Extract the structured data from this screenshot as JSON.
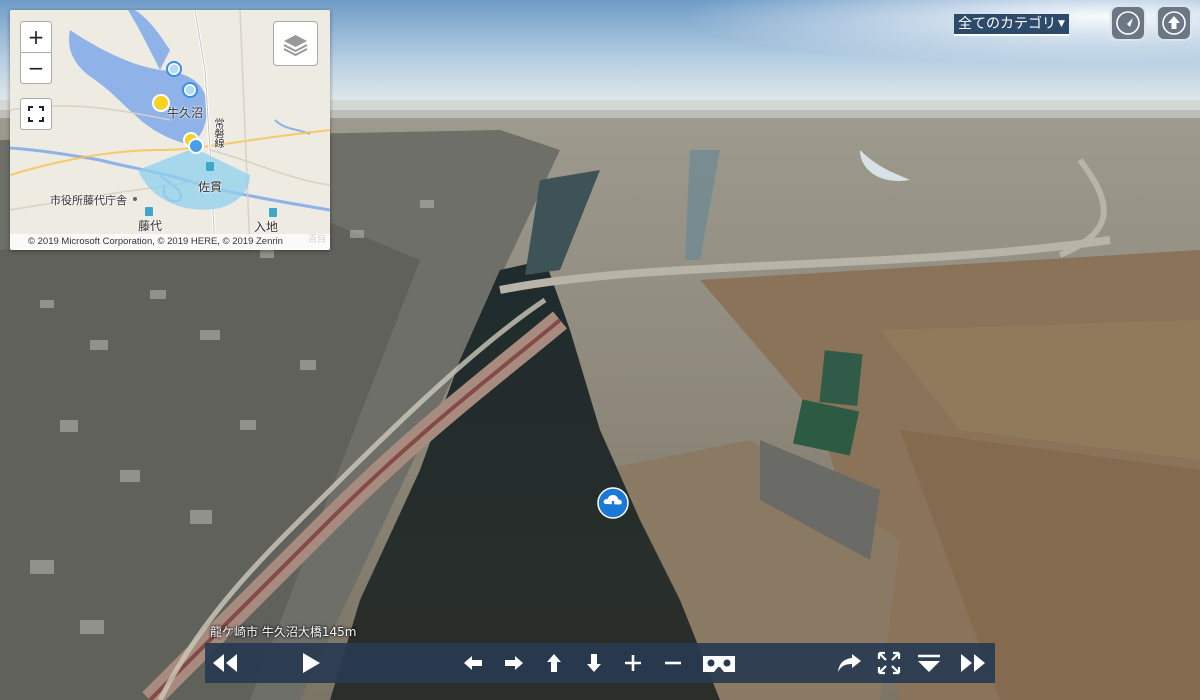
{
  "category_select": {
    "label": "全てのカテゴリ",
    "arrow": "▼"
  },
  "top_buttons": {
    "navigate_icon": "navigation-arrow-icon",
    "home_icon": "up-arrow-home-icon"
  },
  "minimap": {
    "zoom_in": "+",
    "zoom_out": "−",
    "credit": "© 2019 Microsoft Corporation, © 2019 HERE, © 2019 Zenrin",
    "labels": {
      "ushikunuma": "牛久沼",
      "sanuki": "佐貫",
      "fujishiro": "藤代",
      "city_office": "市役所藤代庁舎",
      "iriji": "入地",
      "joban": "常磐線",
      "shinmeiji": "百目"
    },
    "colors": {
      "water": "#8fb3e8",
      "fov": "#8fd0ee",
      "marker_blue": "#3a8fe0",
      "marker_yellow": "#f5d226"
    }
  },
  "hotspot": {
    "icon": "cloud-download-icon",
    "color": "#1a78d6"
  },
  "caption": {
    "text": "龍ケ崎市 牛久沼大橋145m"
  },
  "toolbar": {
    "icons": [
      "fast-rewind-icon",
      "play-icon",
      "left-arrow-icon",
      "right-arrow-icon",
      "up-arrow-icon",
      "down-arrow-icon",
      "zoom-in-plus-icon",
      "zoom-out-minus-icon",
      "vr-headset-icon",
      "share-icon",
      "fullscreen-icon",
      "hide-toolbar-icon",
      "fast-forward-icon"
    ],
    "background": "#283a50"
  }
}
